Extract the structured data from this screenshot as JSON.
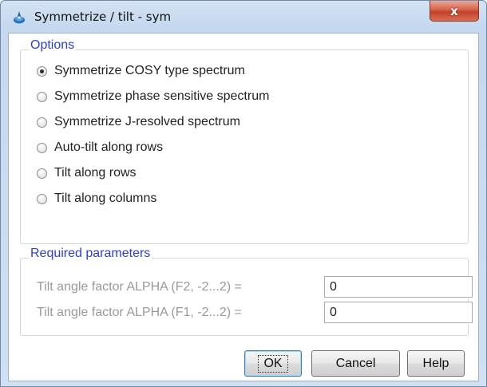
{
  "window": {
    "title": "Symmetrize / tilt - sym",
    "close_label": "x"
  },
  "options": {
    "legend": "Options",
    "items": [
      {
        "label": "Symmetrize COSY type spectrum",
        "checked": true
      },
      {
        "label": "Symmetrize phase sensitive spectrum",
        "checked": false
      },
      {
        "label": "Symmetrize J-resolved spectrum",
        "checked": false
      },
      {
        "label": "Auto-tilt along rows",
        "checked": false
      },
      {
        "label": "Tilt along rows",
        "checked": false
      },
      {
        "label": "Tilt along columns",
        "checked": false
      }
    ]
  },
  "params": {
    "legend": "Required parameters",
    "rows": [
      {
        "label": "Tilt angle factor ALPHA (F2, -2...2) =",
        "value": "0"
      },
      {
        "label": "Tilt angle factor ALPHA (F1, -2...2) =",
        "value": "0"
      }
    ]
  },
  "buttons": {
    "ok": "OK",
    "cancel": "Cancel",
    "help": "Help"
  },
  "colors": {
    "legend_text": "#2d3fcb",
    "close_button": "#c3412a"
  }
}
